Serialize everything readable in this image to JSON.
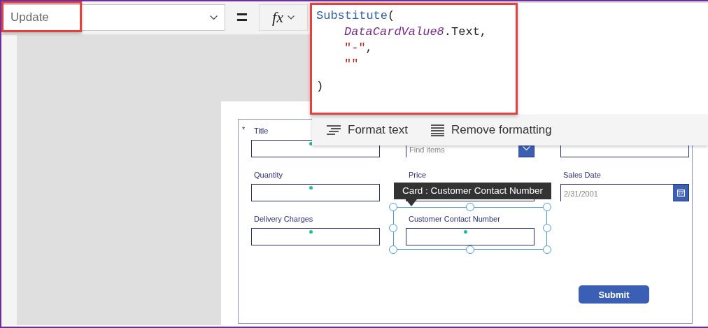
{
  "formula_bar": {
    "property": "Update",
    "equals": "=",
    "fx_label": "fx",
    "formula": {
      "function": "Substitute",
      "open": "(",
      "args": [
        [
          {
            "kind": "control",
            "text": "DataCardValue8"
          },
          {
            "kind": "plain",
            "text": ".Text,"
          }
        ],
        [
          {
            "kind": "string",
            "text": "\"-\""
          },
          {
            "kind": "plain",
            "text": ","
          }
        ],
        [
          {
            "kind": "string",
            "text": "\"\""
          }
        ]
      ],
      "close": ")"
    }
  },
  "format_actions": [
    {
      "kind": "format",
      "label": "Format text"
    },
    {
      "kind": "remove",
      "label": "Remove formatting"
    }
  ],
  "form": {
    "cards": [
      {
        "kind": "text",
        "label": "Title",
        "required_mark": "*",
        "marker": true,
        "selected": false
      },
      {
        "kind": "combo",
        "placeholder": "Find items",
        "marker": false,
        "selected": false
      },
      {
        "kind": "text",
        "marker": false,
        "selected": false
      },
      {
        "kind": "text",
        "label": "Quantity",
        "marker": true,
        "selected": false
      },
      {
        "kind": "text",
        "label": "Price",
        "marker": false,
        "selected": false
      },
      {
        "kind": "date",
        "label": "Sales Date",
        "value": "2/31/2001",
        "marker": false,
        "selected": false
      },
      {
        "kind": "text",
        "label": "Delivery Charges",
        "marker": true,
        "selected": false
      },
      {
        "kind": "text",
        "label": "Customer Contact Number",
        "marker": true,
        "selected": true
      }
    ],
    "submit": "Submit"
  },
  "tooltip": "Card : Customer Contact Number"
}
